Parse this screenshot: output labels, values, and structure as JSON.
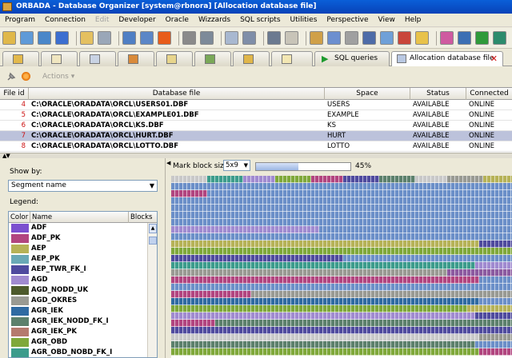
{
  "window": {
    "title": "ORBADA - Database Organizer [system@rbnora] [Allocation database file]"
  },
  "menubar": {
    "items": [
      {
        "label": "Program",
        "enabled": true
      },
      {
        "label": "Connection",
        "enabled": true
      },
      {
        "label": "Edit",
        "enabled": false
      },
      {
        "label": "Developer",
        "enabled": true
      },
      {
        "label": "Oracle",
        "enabled": true
      },
      {
        "label": "Wizzards",
        "enabled": true
      },
      {
        "label": "SQL scripts",
        "enabled": true
      },
      {
        "label": "Utilities",
        "enabled": true
      },
      {
        "label": "Perspective",
        "enabled": true
      },
      {
        "label": "View",
        "enabled": true
      },
      {
        "label": "Help",
        "enabled": true
      }
    ]
  },
  "tabs": {
    "sql_queries": "SQL queries",
    "allocation": "Allocation database file"
  },
  "actionbar": {
    "actions_label": "Actions"
  },
  "datafiles": {
    "columns": [
      "File id",
      "Database file",
      "Space",
      "Status",
      "Connected"
    ],
    "rows": [
      {
        "id": "4",
        "file": "C:\\ORACLE\\ORADATA\\ORCL\\USERS01.DBF",
        "space": "USERS",
        "status": "AVAILABLE",
        "connected": "ONLINE",
        "selected": false
      },
      {
        "id": "5",
        "file": "C:\\ORACLE\\ORADATA\\ORCL\\EXAMPLE01.DBF",
        "space": "EXAMPLE",
        "status": "AVAILABLE",
        "connected": "ONLINE",
        "selected": false
      },
      {
        "id": "6",
        "file": "C:\\ORACLE\\ORADATA\\ORCL\\KS.DBF",
        "space": "KS",
        "status": "AVAILABLE",
        "connected": "ONLINE",
        "selected": false
      },
      {
        "id": "7",
        "file": "C:\\ORACLE\\ORADATA\\ORCL\\HURT.DBF",
        "space": "HURT",
        "status": "AVAILABLE",
        "connected": "ONLINE",
        "selected": true
      },
      {
        "id": "8",
        "file": "C:\\ORACLE\\ORADATA\\ORCL\\LOTTO.DBF",
        "space": "LOTTO",
        "status": "AVAILABLE",
        "connected": "ONLINE",
        "selected": false
      }
    ]
  },
  "showby": {
    "label": "Show by:",
    "value": "Segment name"
  },
  "legend": {
    "label": "Legend:",
    "columns": [
      "Color",
      "Name",
      "Blocks"
    ],
    "items": [
      {
        "name": "ADF",
        "color": "#7b4fcf"
      },
      {
        "name": "ADF_PK",
        "color": "#b2457f"
      },
      {
        "name": "AEP",
        "color": "#b6b257"
      },
      {
        "name": "AEP_PK",
        "color": "#6aa9b6"
      },
      {
        "name": "AEP_TWR_FK_I",
        "color": "#4f4a9e"
      },
      {
        "name": "AGD",
        "color": "#a08ad0"
      },
      {
        "name": "AGD_NODD_UK",
        "color": "#4d5a2c"
      },
      {
        "name": "AGD_OKRES",
        "color": "#999a93"
      },
      {
        "name": "AGR_IEK",
        "color": "#2f6aa2"
      },
      {
        "name": "AGR_IEK_NODD_FK_I",
        "color": "#5c806c"
      },
      {
        "name": "AGR_IEK_PK",
        "color": "#b57a6e"
      },
      {
        "name": "AGR_OBD",
        "color": "#7fa83a"
      },
      {
        "name": "AGR_OBD_NOBD_FK_I",
        "color": "#3c9c8c"
      }
    ]
  },
  "allocation": {
    "mark_block_size_label": "Mark block size:",
    "mark_block_size": "5x9",
    "progress_fraction": 0.45,
    "progress_label": "45%"
  }
}
